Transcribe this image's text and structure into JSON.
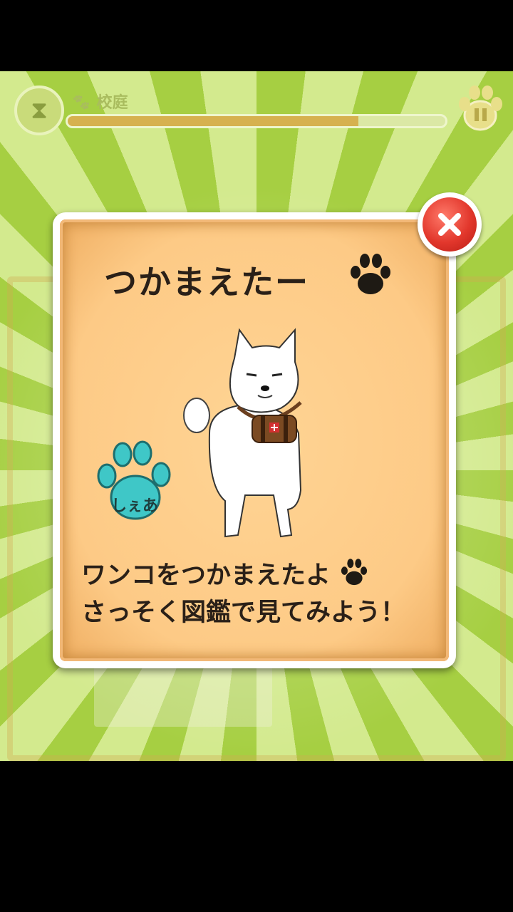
{
  "hud": {
    "stage_label": "校庭",
    "timer_icon": "hourglass-icon",
    "progress": 0.77,
    "pause_icon": "pause-icon"
  },
  "dialog": {
    "title": "つかまえたー",
    "title_icon": "paw-icon",
    "character_image": "white-dog-with-barrel",
    "badge": {
      "icon": "paw-icon",
      "color": "#3fc7c7",
      "label": "しぇあ"
    },
    "message_line1": "ワンコをつかまえたよ",
    "message_line2": "さっそく図鑑で見てみよう！",
    "close_icon": "close-icon"
  },
  "colors": {
    "ray_dark": "#a6cf42",
    "ray_light": "#d3ea8e",
    "paper": "#fdca86",
    "close_red": "#e2372c",
    "text": "#2a2018"
  }
}
